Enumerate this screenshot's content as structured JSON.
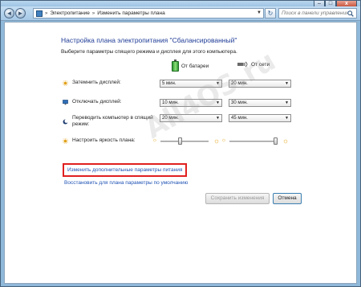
{
  "window": {
    "minimize": "–",
    "maximize": "□",
    "close": "x"
  },
  "nav": {
    "back_glyph": "◄",
    "forward_glyph": "►",
    "breadcrumb_sep": "»",
    "breadcrumb": [
      "Электропитание",
      "Изменить параметры плана"
    ],
    "refresh_glyph": "↻",
    "search_placeholder": "Поиск в панели управления"
  },
  "page": {
    "title": "Настройка плана электропитания \"Сбалансированный\"",
    "subtitle": "Выберите параметры спящего режима и дисплея для этого компьютера."
  },
  "columns": {
    "battery": "От батареи",
    "ac": "От сети"
  },
  "settings": [
    {
      "label": "Затемнить дисплей:",
      "battery": "5 мин.",
      "ac": "20 мин."
    },
    {
      "label": "Отключать дисплей:",
      "battery": "10 мин.",
      "ac": "30 мин."
    },
    {
      "label": "Переводить компьютер в спящий режим:",
      "battery": "20 мин.",
      "ac": "45 мин."
    }
  ],
  "brightness": {
    "label": "Настроить яркость плана:",
    "battery_level": 0.4,
    "ac_level": 1.0
  },
  "links": {
    "advanced": "Изменить дополнительные параметры питания",
    "restore": "Восстановить для плана параметры по умолчанию"
  },
  "buttons": {
    "save": "Сохранить изменения",
    "cancel": "Отмена"
  },
  "watermark": "All4OS.ru",
  "colors": {
    "title": "#1e3b96",
    "link": "#1f53b5",
    "highlight_box": "#e02020"
  },
  "icons": {
    "arrow": "▼",
    "sun_small": "☼",
    "sun_big": "☼"
  }
}
